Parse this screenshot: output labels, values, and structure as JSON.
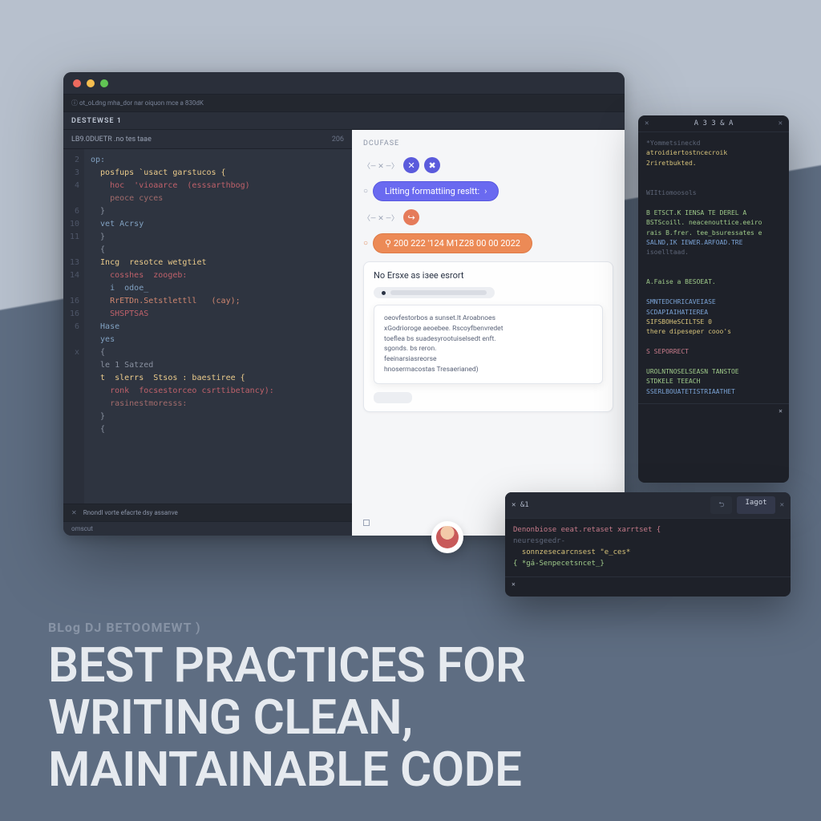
{
  "hero": {
    "category": "BLog DJ BETOOMEWT )",
    "title_l1": "BEST PRACTICES FOR",
    "title_l2": "WRITING CLEAN,",
    "title_l3": "MAINTAINABLE CODE"
  },
  "editor": {
    "tabbar": "ⓘ  ot_oLdng  mha_dor  nar oiquon  mce a  830dK",
    "explorer": "DESTEWSE 1",
    "filetab_name": "LB9.0DUETR .no  tes  taae",
    "filetab_num": "206",
    "gutter": [
      "2",
      "3",
      "4",
      "",
      "6",
      "10",
      "11",
      "",
      "13",
      "14",
      "",
      "16",
      "16",
      "6",
      "",
      "x"
    ],
    "code": [
      {
        "t": "kw",
        "s": "op:"
      },
      {
        "t": "fn",
        "s": "  posfups `usact garstucos {"
      },
      {
        "t": "err",
        "s": "    hoc  'vioaarce  (esssarthbog)"
      },
      {
        "t": "str",
        "s": "    peoce cyces"
      },
      {
        "t": "pun",
        "s": "  }"
      },
      {
        "t": "kw",
        "s": "  vet Acrsy"
      },
      {
        "t": "pun",
        "s": "  }"
      },
      {
        "t": "pun",
        "s": "  {"
      },
      {
        "t": "fn",
        "s": "  Incg  resotce wetgtiet"
      },
      {
        "t": "err",
        "s": "    cosshes  zoogeb:"
      },
      {
        "t": "kw",
        "s": "    i  odoe_"
      },
      {
        "t": "var",
        "s": "    RrETDn.Setstlettll   (cay);"
      },
      {
        "t": "err",
        "s": "    SHSPTSAS"
      },
      {
        "t": "kw",
        "s": "  Hase"
      },
      {
        "t": "kw",
        "s": "  yes"
      },
      {
        "t": "pun",
        "s": "  {"
      },
      {
        "t": "pun",
        "s": "  le 1 Satzed"
      },
      {
        "t": "fn",
        "s": "  t  slerrs  Stsos : baestiree {"
      },
      {
        "t": "err",
        "s": "    ronk  focsestorceo csrttibetancy):"
      },
      {
        "t": "str",
        "s": "    rasinestmoresss:"
      },
      {
        "t": "pun",
        "s": "  }"
      },
      {
        "t": "pun",
        "s": "  {"
      }
    ],
    "status_x": "✕",
    "status_text": "Rnondl  vorte efacrte  dsy  assanve",
    "lower_status": "omscut"
  },
  "panel": {
    "tab": "DCUFASE",
    "row1_arrow": "〈— ✕ —〉",
    "lint_label": "Litting formattiing resltt:",
    "row2_arrow": "〈— ✕ —〉",
    "orange_pill": "⚲ 200 222 '124 M1Z28 00 00 2022",
    "card_title": "No Ersxe as iзee esrort",
    "tooltip": "oeovfestorbos a sunset.lt  Aroabnoes\nxGodrioroge aeoebee.   Rscoyfbenvredet\n  toeflea bs  suadesyrootuiselsedt enft.\nsgonds. bs  reron.\n  feeinarsiasreorse\nhnosermacostas  Tresaerianed)",
    "footer": "□"
  },
  "avatar": {
    "name": "user-avatar"
  },
  "float_tall": {
    "title": "А 3 З & А",
    "lines": [
      {
        "c": "d",
        "s": "*Yommetsineckd"
      },
      {
        "c": "y",
        "s": "atroidiertostncecroik"
      },
      {
        "c": "y",
        "s": "2riretbukted."
      },
      {
        "c": "d",
        "s": ""
      },
      {
        "c": "d",
        "s": ""
      },
      {
        "c": "d",
        "s": "WIItiomoosols"
      },
      {
        "c": "d",
        "s": ""
      },
      {
        "c": "g",
        "s": "B ETSCT.K IENSA TE DEREL A"
      },
      {
        "c": "g",
        "s": "BSTScoill. neacenouttice.eeiro"
      },
      {
        "c": "g",
        "s": "rais B.frer. tee_bsuressates e"
      },
      {
        "c": "b",
        "s": "SALND,IK IEWER.ARFOAD.TRE"
      },
      {
        "c": "d",
        "s": "isoelltaad."
      },
      {
        "c": "d",
        "s": ""
      },
      {
        "c": "d",
        "s": ""
      },
      {
        "c": "g",
        "s": "A.Faise a BESOEAT."
      },
      {
        "c": "d",
        "s": ""
      },
      {
        "c": "b",
        "s": "SMNTEDCHRICAVEIASE"
      },
      {
        "c": "b",
        "s": "SCDAPIAIHATIEREA"
      },
      {
        "c": "y",
        "s": "SIFSBOHeSCILTSE 0"
      },
      {
        "c": "y",
        "s": "there dipeseper cooo's"
      },
      {
        "c": "d",
        "s": ""
      },
      {
        "c": "r",
        "s": "S SEPORRECT"
      },
      {
        "c": "d",
        "s": ""
      },
      {
        "c": "g",
        "s": "UROLNTNOSELSEASN TANSTOE"
      },
      {
        "c": "g",
        "s": "STDKELE TEEACH"
      },
      {
        "c": "b",
        "s": "SSERLBOUATETISTRIAATHET"
      }
    ],
    "foot_x": "✕"
  },
  "float_short": {
    "title_marker": "✕ &1",
    "tab1": "⮌",
    "tab2": "Iagot",
    "lines": [
      {
        "c": "r",
        "s": "Denonbiose eeat.retaset xarrtset {"
      },
      {
        "c": "d",
        "s": "neuresgeedr-"
      },
      {
        "c": "y",
        "s": "  sonnzesecarcnsest \"e_ces*"
      },
      {
        "c": "g",
        "s": "{ *gá-Senpecetsncet_}"
      }
    ],
    "foot_x": "✕"
  }
}
